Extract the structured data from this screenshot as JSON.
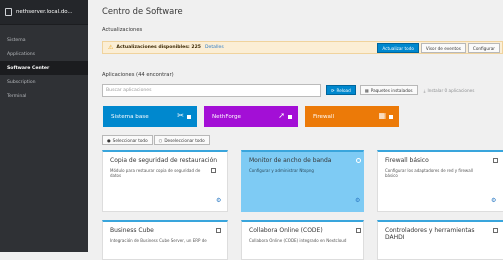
{
  "sidebar": {
    "host": "nethserver.local.do...",
    "items": [
      {
        "label": "Sistema"
      },
      {
        "label": "Applications"
      },
      {
        "label": "Software Center"
      },
      {
        "label": "Subscription"
      },
      {
        "label": "Terminal"
      }
    ]
  },
  "page": {
    "title": "Centro de Software",
    "updates_heading": "Actualizaciones",
    "apps_heading": "Aplicaciones (44 encontrar)"
  },
  "alert": {
    "text": "Actualizaciones disponibles: 225",
    "link": "Detalles",
    "buttons": [
      "Actualizar todo",
      "Visor de eventos",
      "Configurar"
    ]
  },
  "search": {
    "placeholder": "Buscar aplicaciones",
    "reload": "Reload",
    "installed": "Paquetes instalados",
    "install_selected": "Instalar 0 aplicaciones"
  },
  "tiles": [
    {
      "label": "Sistema base",
      "color": "#0088ce"
    },
    {
      "label": "NethForge",
      "color": "#a30fd6"
    },
    {
      "label": "Firewall",
      "color": "#ec7a08"
    }
  ],
  "selection": {
    "select_all": "Seleccionar todo",
    "deselect_all": "Deseleccionar todo"
  },
  "cards": [
    {
      "title": "Copia de seguridad de restauración",
      "desc": "Módulo para restaurar copia de seguridad de datos"
    },
    {
      "title": "Monitor de ancho de banda",
      "desc": "Configurar y administrar Ntopng"
    },
    {
      "title": "Firewall básico",
      "desc": "Configurar los adaptadores de red y firewall básico"
    },
    {
      "title": "Business Cube",
      "desc": "Integración de Business Cube Server, un ERP de"
    },
    {
      "title": "Collabora Online (CODE)",
      "desc": "Collabora Online (CODE) integrado en Nextcloud"
    },
    {
      "title": "Controladores y herramientas DAHDI",
      "desc": ""
    }
  ]
}
